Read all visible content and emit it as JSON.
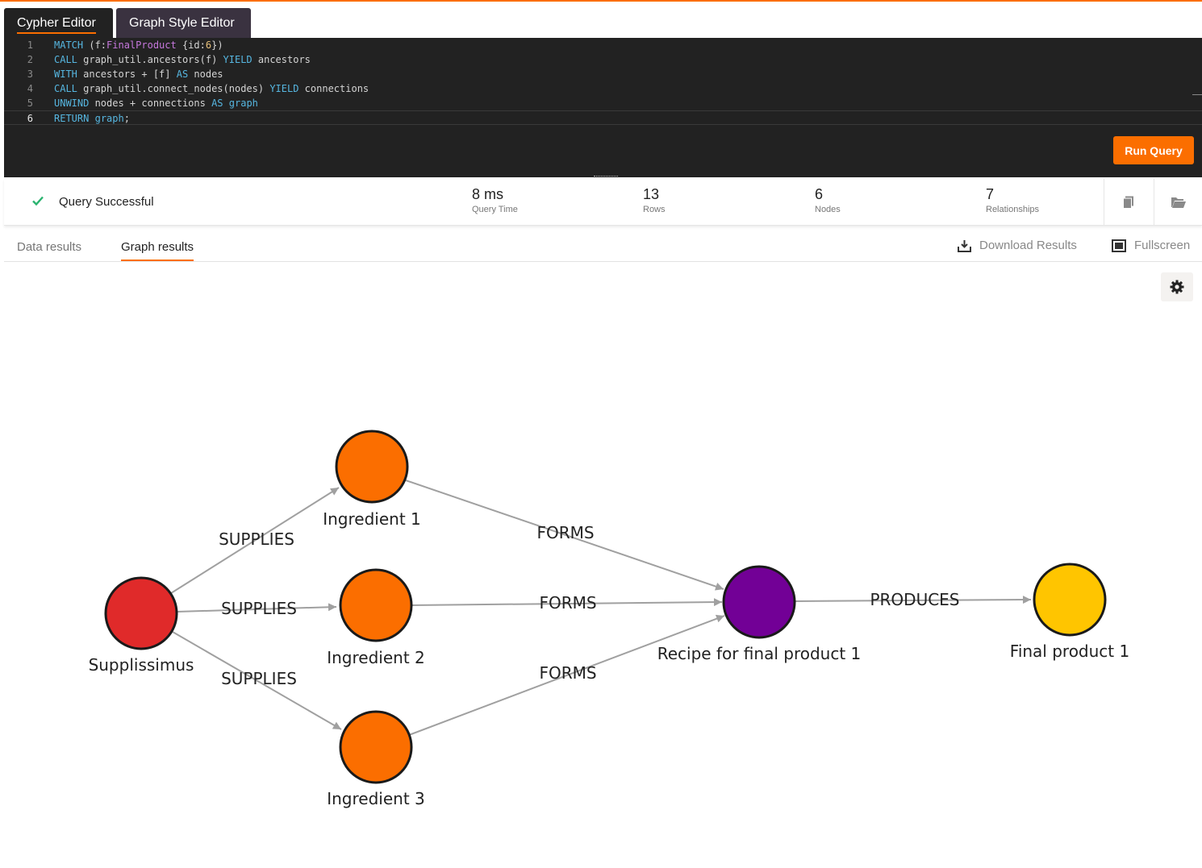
{
  "tabs": {
    "cypher": "Cypher Editor",
    "style": "Graph Style Editor"
  },
  "editor": {
    "lines": [
      {
        "n": "1"
      },
      {
        "n": "2"
      },
      {
        "n": "3"
      },
      {
        "n": "4"
      },
      {
        "n": "5"
      },
      {
        "n": "6"
      }
    ],
    "run_label": "Run Query"
  },
  "status": {
    "message": "Query Successful",
    "stats": [
      {
        "value": "8 ms",
        "label": "Query Time"
      },
      {
        "value": "13",
        "label": "Rows"
      },
      {
        "value": "6",
        "label": "Nodes"
      },
      {
        "value": "7",
        "label": "Relationships"
      }
    ]
  },
  "results": {
    "tab_data": "Data results",
    "tab_graph": "Graph results",
    "download": "Download Results",
    "fullscreen": "Fullscreen"
  },
  "graph": {
    "nodes": [
      {
        "id": "supplier",
        "label": "Supplissimus",
        "color": "#e02a2a"
      },
      {
        "id": "ing1",
        "label": "Ingredient 1",
        "color": "#fb6e00"
      },
      {
        "id": "ing2",
        "label": "Ingredient 2",
        "color": "#fb6e00"
      },
      {
        "id": "ing3",
        "label": "Ingredient 3",
        "color": "#fb6e00"
      },
      {
        "id": "recipe",
        "label": "Recipe for final product 1",
        "color": "#720096"
      },
      {
        "id": "final",
        "label": "Final product 1",
        "color": "#ffc500"
      }
    ],
    "edges": [
      {
        "from": "supplier",
        "to": "ing1",
        "label": "SUPPLIES"
      },
      {
        "from": "supplier",
        "to": "ing2",
        "label": "SUPPLIES"
      },
      {
        "from": "supplier",
        "to": "ing3",
        "label": "SUPPLIES"
      },
      {
        "from": "ing1",
        "to": "recipe",
        "label": "FORMS"
      },
      {
        "from": "ing2",
        "to": "recipe",
        "label": "FORMS"
      },
      {
        "from": "ing3",
        "to": "recipe",
        "label": "FORMS"
      },
      {
        "from": "recipe",
        "to": "final",
        "label": "PRODUCES"
      }
    ]
  },
  "colors": {
    "accent": "#fb6e00",
    "editor_bg": "#222222",
    "success": "#2ab36f"
  }
}
